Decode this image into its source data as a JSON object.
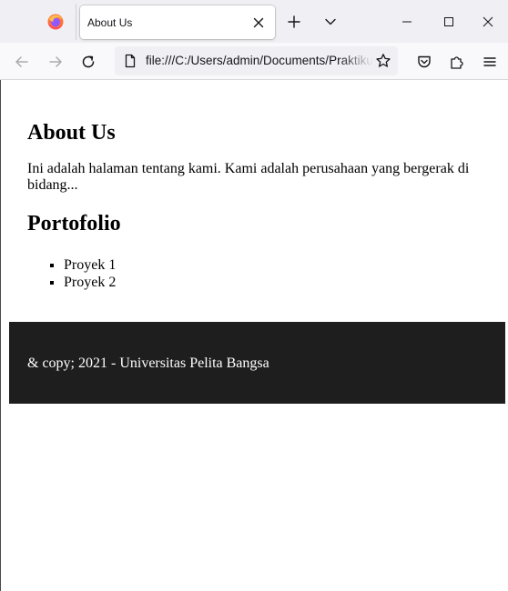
{
  "browser": {
    "tab": {
      "title": "About Us",
      "close_icon": "close-icon"
    },
    "toolbar": {
      "url": "file:///C:/Users/admin/Documents/Praktikum",
      "back_icon": "arrow-left-icon",
      "forward_icon": "arrow-right-icon",
      "reload_icon": "reload-icon",
      "page_icon": "file-icon",
      "bookmark_icon": "star-icon",
      "pocket_icon": "pocket-icon",
      "extensions_icon": "puzzle-icon",
      "menu_icon": "hamburger-menu-icon"
    },
    "window_controls": [
      "minimize-icon",
      "maximize-icon",
      "close-icon"
    ]
  },
  "page": {
    "heading": "About Us",
    "intro": "Ini adalah halaman tentang kami. Kami adalah perusahaan yang bergerak di bidang...",
    "portfolio_heading": "Portofolio",
    "portfolio_items": [
      "Proyek 1",
      "Proyek 2"
    ],
    "footer_text": "& copy; 2021 - Universitas Pelita Bangsa"
  },
  "colors": {
    "footer_background": "#1e1e1e",
    "footer_text": "#ffffff",
    "tabbar_background": "#f0f0f4"
  }
}
